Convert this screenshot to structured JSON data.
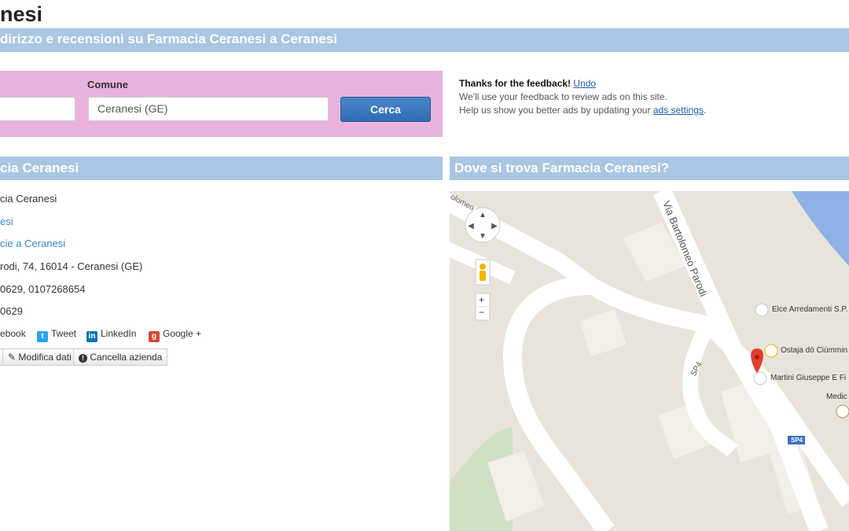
{
  "page": {
    "title": "nesi",
    "subtitle": "dirizzo e recensioni su Farmacia Ceranesi a Ceranesi"
  },
  "search": {
    "comune_label": "Comune",
    "comune_value": "Ceranesi (GE)",
    "button": "Cerca"
  },
  "feedback": {
    "thanks": "Thanks for the feedback!",
    "undo": "Undo",
    "line1": "We'll use your feedback to review ads on this site.",
    "line2_prefix": "Help us show you better ads by updating your ",
    "line2_link": "ads settings",
    "line2_suffix": "."
  },
  "info": {
    "header": "cia Ceranesi",
    "name": "cia Ceranesi",
    "link1": "esi",
    "link2": "cie a Ceranesi",
    "address": "rodi, 74, 16014 - Ceranesi (GE)",
    "phones": "0629, 0107268654",
    "fax": "0629",
    "social": {
      "facebook": "ebook",
      "twitter": "Tweet",
      "linkedin": "LinkedIn",
      "google": "Google +"
    },
    "edit_button": "Modifica dati",
    "delete_button": "Cancella azienda"
  },
  "map": {
    "header": "Dove si trova Farmacia Ceranesi?",
    "street_label": "Via Bartolomeo Parodi",
    "corner_street": "olomeo",
    "sp4_road": "SP4",
    "sp4_badge": "SP4",
    "places": [
      "Elce Arredamenti S.P.",
      "Ostaja dò Ciùmmin",
      "Martini Giuseppe E Fi",
      "Medic"
    ],
    "zoom_in": "+",
    "zoom_out": "−"
  },
  "colors": {
    "band": "#a9c6e2",
    "search_box": "#e9b2dd",
    "button": "#2f6db4",
    "link": "#3a87c8"
  }
}
